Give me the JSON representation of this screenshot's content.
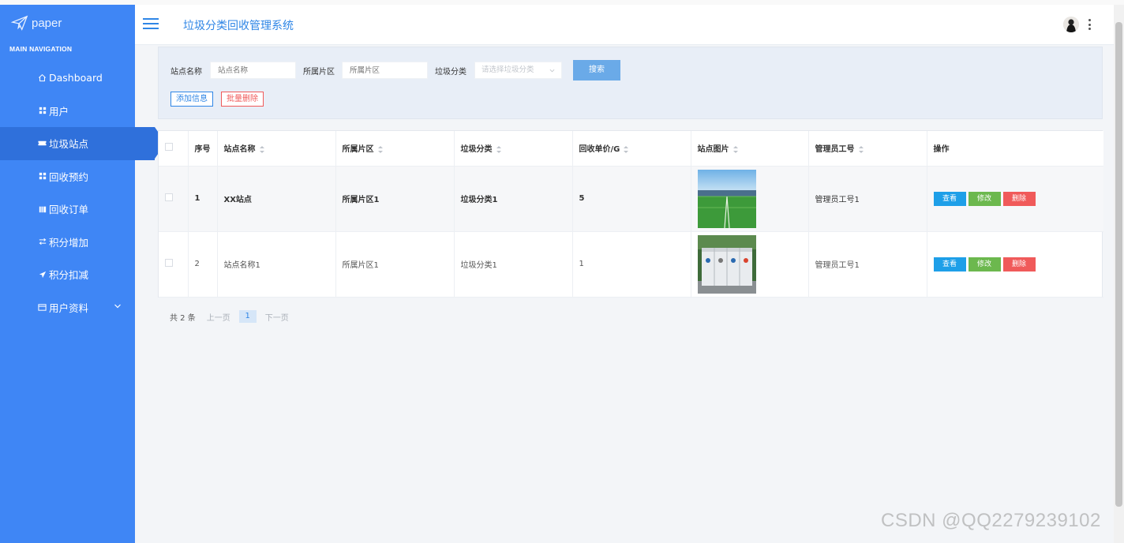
{
  "logo": {
    "text": "paper",
    "icon": "paper-plane-icon"
  },
  "sidebar": {
    "heading": "MAIN NAVIGATION",
    "items": [
      {
        "label": "Dashboard",
        "icon": "home-icon"
      },
      {
        "label": "用户",
        "icon": "grid-icon"
      },
      {
        "label": "垃圾站点",
        "icon": "ticket-icon",
        "active": true
      },
      {
        "label": "回收预约",
        "icon": "grid-icon"
      },
      {
        "label": "回收订单",
        "icon": "bars-icon"
      },
      {
        "label": "积分增加",
        "icon": "sliders-icon"
      },
      {
        "label": "积分扣减",
        "icon": "send-icon"
      },
      {
        "label": "用户资料",
        "icon": "card-icon",
        "expandable": true
      }
    ]
  },
  "header": {
    "title": "垃圾分类回收管理系统"
  },
  "search": {
    "name_label": "站点名称",
    "name_placeholder": "站点名称",
    "area_label": "所属片区",
    "area_placeholder": "所属片区",
    "category_label": "垃圾分类",
    "category_placeholder": "请选择垃圾分类",
    "search_button": "搜索",
    "add_button": "添加信息",
    "batch_delete_button": "批量删除"
  },
  "table": {
    "columns": [
      "序号",
      "站点名称",
      "所属片区",
      "垃圾分类",
      "回收单价/G",
      "站点图片",
      "管理员工号",
      "操作"
    ],
    "rows": [
      {
        "index": "1",
        "name": "XX站点",
        "area": "所属片区1",
        "category": "垃圾分类1",
        "price": "5",
        "image": "grass-field-photo",
        "admin": "管理员工号1"
      },
      {
        "index": "2",
        "name": "站点名称1",
        "area": "所属片区1",
        "category": "垃圾分类1",
        "price": "1",
        "image": "recycling-bins-photo",
        "admin": "管理员工号1"
      }
    ],
    "actions": {
      "view": "查看",
      "edit": "修改",
      "delete": "删除"
    }
  },
  "pager": {
    "total": "共 2 条",
    "prev": "上一页",
    "page": "1",
    "next": "下一页"
  },
  "watermark": "CSDN @QQ2279239102",
  "colors": {
    "sidebar": "#3f86f5",
    "sidebar_active": "#2f70db",
    "accent": "#2f86e6",
    "view": "#1e9fe8",
    "edit": "#6cb84e",
    "delete": "#f05a5a"
  }
}
